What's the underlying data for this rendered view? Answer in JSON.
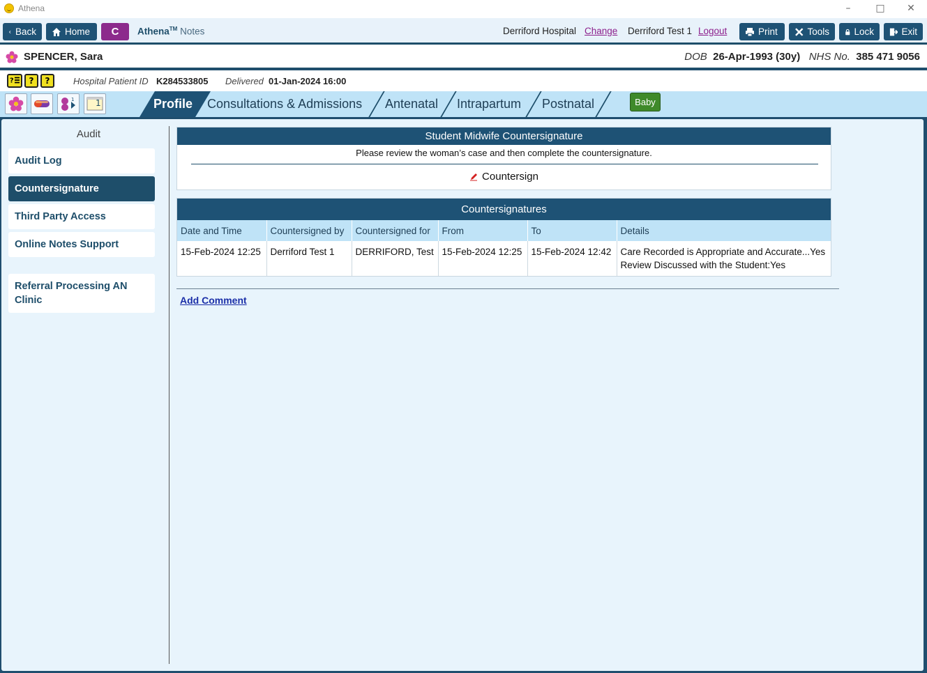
{
  "window": {
    "title": "Athena"
  },
  "toolbar": {
    "back_label": "Back",
    "home_label": "Home",
    "c_label": "C",
    "app_brand": "Athena",
    "app_tm": "TM",
    "app_suffix": "Notes",
    "hospital": "Derriford Hospital",
    "change_link": "Change",
    "user": "Derriford Test 1",
    "logout_link": "Logout",
    "print_label": "Print",
    "tools_label": "Tools",
    "lock_label": "Lock",
    "exit_label": "Exit"
  },
  "patient": {
    "name": "SPENCER, Sara",
    "dob_label": "DOB",
    "dob_value": "26-Apr-1993 (30y)",
    "nhs_label": "NHS No.",
    "nhs_value": "385 471 9056"
  },
  "info": {
    "hospital_id_label": "Hospital Patient ID",
    "hospital_id_value": "K284533805",
    "delivered_label": "Delivered",
    "delivered_value": "01-Jan-2024 16:00",
    "alert_icons": [
      "?",
      "?"
    ],
    "calendar_day": "1"
  },
  "tabs": [
    {
      "label": "Profile",
      "active": true
    },
    {
      "label": "Consultations & Admissions",
      "active": false
    },
    {
      "label": "Antenatal",
      "active": false
    },
    {
      "label": "Intrapartum",
      "active": false
    },
    {
      "label": "Postnatal",
      "active": false
    }
  ],
  "baby_label": "Baby",
  "sidebar": {
    "title": "Audit",
    "items": [
      {
        "label": "Audit Log",
        "active": false
      },
      {
        "label": "Countersignature",
        "active": true
      },
      {
        "label": "Third Party Access",
        "active": false
      },
      {
        "label": "Online Notes Support",
        "active": false
      },
      {
        "label": "Referral Processing AN Clinic",
        "active": false
      }
    ]
  },
  "countersign_panel": {
    "title": "Student Midwife Countersignature",
    "message": "Please review the woman’s case and then complete the countersignature.",
    "action_label": "Countersign"
  },
  "countersignatures": {
    "title": "Countersignatures",
    "columns": [
      "Date and Time",
      "Countersigned by",
      "Countersigned for",
      "From",
      "To",
      "Details"
    ],
    "rows": [
      {
        "datetime": "15-Feb-2024 12:25",
        "by": "Derriford Test 1",
        "for": "DERRIFORD, Test",
        "from": "15-Feb-2024 12:25",
        "to": "15-Feb-2024 12:42",
        "details_1": "Care Recorded is Appropriate and Accurate...Yes",
        "details_2": "Review Discussed with the Student:Yes"
      }
    ]
  },
  "add_comment_label": "Add Comment",
  "colors": {
    "primary": "#1e5275",
    "nav_bg": "#bfe3f7",
    "main_bg": "#e8f4fc",
    "c_button": "#8c2a8c",
    "baby_button": "#3f8a2a",
    "link": "#1a2ea8"
  }
}
